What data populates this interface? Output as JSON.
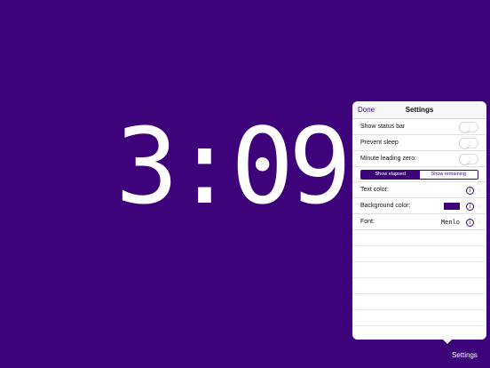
{
  "clock": {
    "time": "3:09"
  },
  "popover": {
    "done_label": "Done",
    "title": "Settings",
    "toggles": [
      {
        "label": "Show status bar",
        "on": false
      },
      {
        "label": "Prevent sleep",
        "on": false
      },
      {
        "label": "Minute leading zero:",
        "on": false
      }
    ],
    "segments": [
      {
        "label": "Show elapsed",
        "selected": true
      },
      {
        "label": "Show remaining",
        "selected": false
      }
    ],
    "text_color_label": "Text color:",
    "background_color_label": "Background color:",
    "background_color_value": "#3d017a",
    "font_label": "Font:",
    "font_value": "Menlo"
  },
  "footer": {
    "settings_label": "Settings"
  },
  "colors": {
    "background": "#3d017a",
    "accent": "#3d017a",
    "text": "#ffffff"
  },
  "icons": {
    "info": "info-circle-icon",
    "chevron": "chevron-right-icon"
  }
}
